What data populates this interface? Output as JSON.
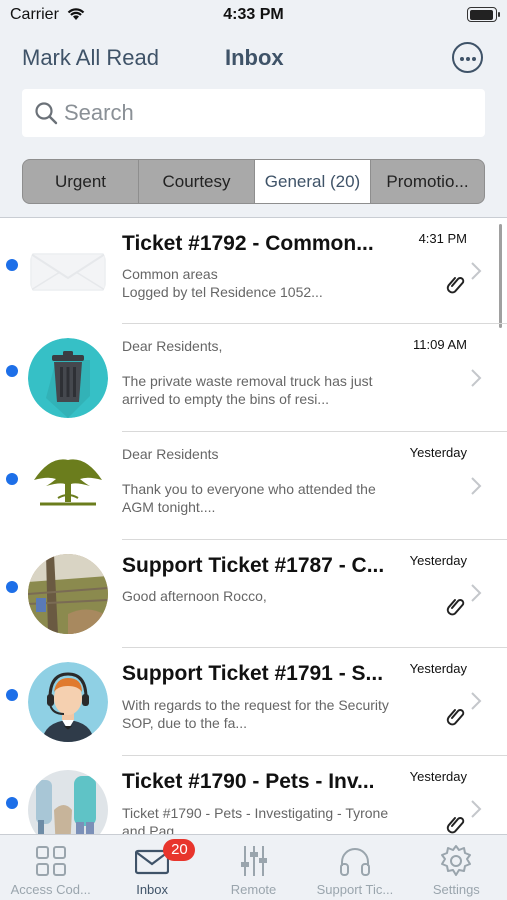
{
  "status_bar": {
    "carrier": "Carrier",
    "time": "4:33 PM"
  },
  "header": {
    "mark_all_read": "Mark All Read",
    "title": "Inbox",
    "more_icon": "more-circle-icon"
  },
  "search": {
    "placeholder": "Search",
    "value": ""
  },
  "segments": [
    {
      "label": "Urgent",
      "selected": false
    },
    {
      "label": "Courtesy",
      "selected": false
    },
    {
      "label": "General (20)",
      "selected": true
    },
    {
      "label": "Promotio...",
      "selected": false
    }
  ],
  "messages": [
    {
      "title": "Ticket #1792 - Common...",
      "subtitle": "Common areas",
      "preview": "Logged by  tel  Residence 1052...",
      "time": "4:31 PM",
      "unread": true,
      "attachment": true,
      "avatar": "envelope"
    },
    {
      "title": "",
      "subtitle": "Dear Residents,",
      "preview": "The private waste removal truck has just arrived to empty the bins of resi...",
      "time": "11:09 AM",
      "unread": true,
      "attachment": false,
      "avatar": "trash-bin"
    },
    {
      "title": "",
      "subtitle": "Dear Residents",
      "preview": "Thank you to everyone who attended the AGM tonight....",
      "time": "Yesterday",
      "unread": true,
      "attachment": false,
      "avatar": "tree-logo"
    },
    {
      "title": "Support Ticket #1787 - C...",
      "subtitle": "Good afternoon Rocco,",
      "preview": "",
      "time": "Yesterday",
      "unread": true,
      "attachment": true,
      "avatar": "photo-fence"
    },
    {
      "title": "Support Ticket #1791 - S...",
      "subtitle": "",
      "preview": "With regards to the request for the Security SOP, due to the fa...",
      "time": "Yesterday",
      "unread": true,
      "attachment": true,
      "avatar": "support-agent"
    },
    {
      "title": "Ticket #1790 - Pets - Inv...",
      "subtitle": "",
      "preview": "Ticket #1790 - Pets - Investigating - Tyrone and Pag...",
      "time": "Yesterday",
      "unread": true,
      "attachment": true,
      "avatar": "photo-people"
    }
  ],
  "tabbar": [
    {
      "label": "Access Cod...",
      "icon": "grid-icon",
      "active": false
    },
    {
      "label": "Inbox",
      "icon": "envelope-icon",
      "active": true,
      "badge": "20"
    },
    {
      "label": "Remote",
      "icon": "sliders-icon",
      "active": false
    },
    {
      "label": "Support Tic...",
      "icon": "headphones-icon",
      "active": false
    },
    {
      "label": "Settings",
      "icon": "gear-icon",
      "active": false
    }
  ],
  "colors": {
    "accent": "#3f5368",
    "unread": "#1d6fe8",
    "badge": "#e8352c",
    "header_bg": "#eef1f5"
  }
}
